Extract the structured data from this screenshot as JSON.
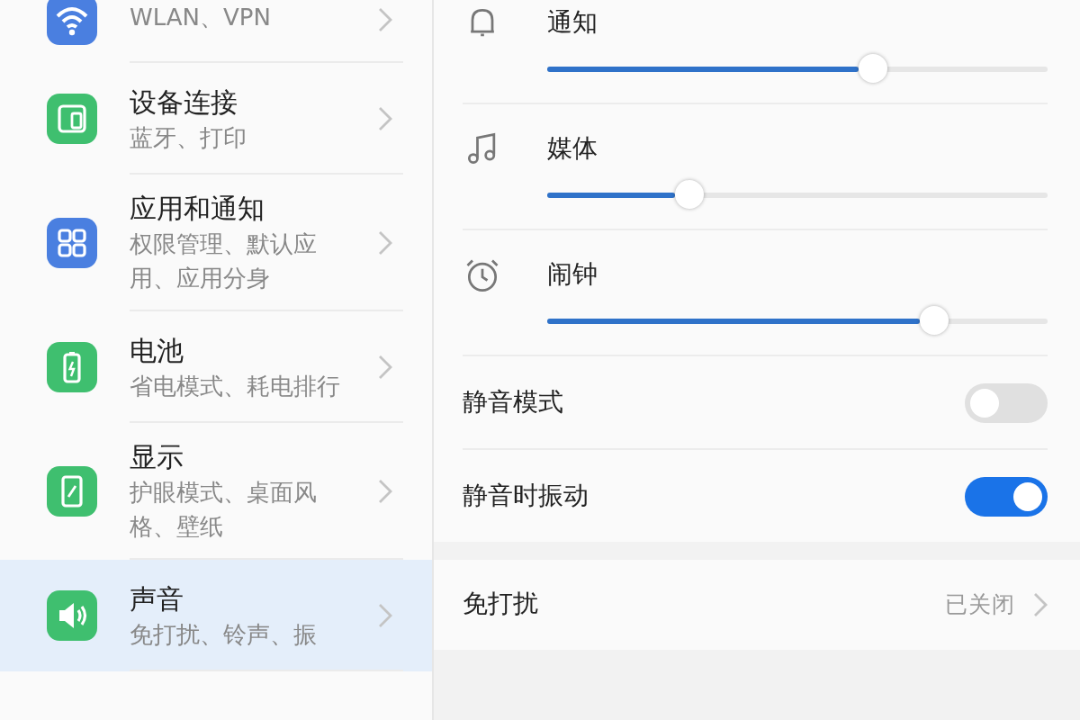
{
  "sidebar": {
    "items": [
      {
        "kind": "wifi",
        "color": "#4a7fe0",
        "subtitle": "WLAN、VPN",
        "selected": false
      },
      {
        "kind": "devices",
        "color": "#3fbf6f",
        "title": "设备连接",
        "subtitle": "蓝牙、打印",
        "selected": false
      },
      {
        "kind": "apps",
        "color": "#4a7fe0",
        "title": "应用和通知",
        "subtitle": "权限管理、默认应用、应用分身",
        "selected": false
      },
      {
        "kind": "battery",
        "color": "#3fbf6f",
        "title": "电池",
        "subtitle": "省电模式、耗电排行",
        "selected": false
      },
      {
        "kind": "display",
        "color": "#3fbf6f",
        "title": "显示",
        "subtitle": "护眼模式、桌面风格、壁纸",
        "selected": false
      },
      {
        "kind": "sound",
        "color": "#3fbf6f",
        "title": "声音",
        "subtitle": "免打扰、铃声、振",
        "selected": true
      }
    ]
  },
  "volumes": [
    {
      "kind": "bell",
      "label": "通知",
      "level": 0.66
    },
    {
      "kind": "music",
      "label": "媒体",
      "level": 0.27
    },
    {
      "kind": "alarm",
      "label": "闹钟",
      "level": 0.79
    }
  ],
  "toggles": [
    {
      "label": "静音模式",
      "on": false
    },
    {
      "label": "静音时振动",
      "on": true
    }
  ],
  "dnd": {
    "label": "免打扰",
    "value": "已关闭"
  }
}
